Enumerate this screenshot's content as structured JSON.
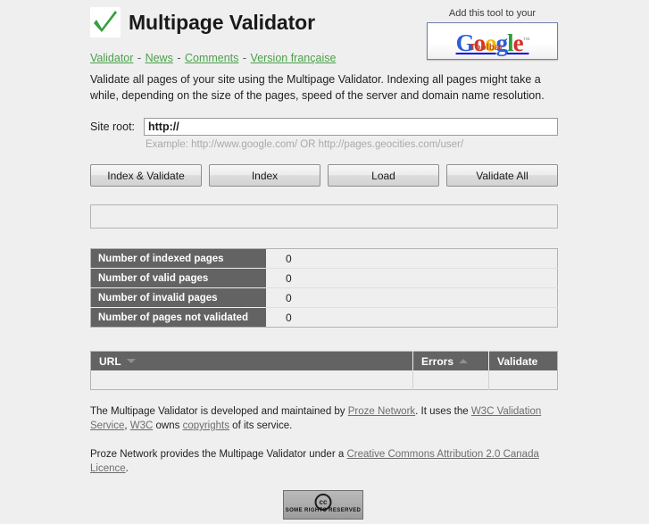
{
  "header": {
    "title": "Multipage Validator",
    "logo_icon": "green-checkmark-icon",
    "nav": [
      {
        "label": "Validator"
      },
      {
        "label": "News"
      },
      {
        "label": "Comments"
      },
      {
        "label": "Version française"
      }
    ],
    "nav_separator": "-"
  },
  "promo": {
    "caption": "Add this tool to your",
    "logo_letters": {
      "g1": "G",
      "o1": "o",
      "o2": "o",
      "g2": "g",
      "l1": "l",
      "e1": "e",
      "tm": "™"
    },
    "toolbar_word": "Toolbar"
  },
  "intro": {
    "text": "Validate all pages of your site using the Multipage Validator. Indexing all pages might take a while, depending on the size of the pages, speed of the server and domain name resolution."
  },
  "form": {
    "site_root_label": "Site root:",
    "site_root_value": "http://",
    "site_root_placeholder": "http://",
    "example_hint": "Example: http://www.google.com/ OR http://pages.geocities.com/user/"
  },
  "buttons": [
    {
      "label": "Index & Validate"
    },
    {
      "label": "Index"
    },
    {
      "label": "Load"
    },
    {
      "label": "Validate All"
    }
  ],
  "status": {
    "message": ""
  },
  "stats": {
    "rows": [
      {
        "label": "Number of indexed pages",
        "value": "0"
      },
      {
        "label": "Number of valid pages",
        "value": "0"
      },
      {
        "label": "Number of invalid pages",
        "value": "0"
      },
      {
        "label": "Number of pages not validated",
        "value": "0"
      }
    ]
  },
  "url_table": {
    "columns": [
      {
        "label": "URL",
        "sort": "desc"
      },
      {
        "label": "Errors",
        "sort": "asc"
      },
      {
        "label": "Validate",
        "sort": "none"
      }
    ],
    "rows": []
  },
  "footer": {
    "line1_a": "The Multipage Validator is developed and maintained by ",
    "link_prose": "Proze Network",
    "line1_b": ". It uses the ",
    "link_w3c_validation": "W3C Validation Service",
    "line1_c": ", ",
    "link_w3c": "W3C",
    "line1_d": " owns ",
    "link_copyrights": "copyrights",
    "line1_e": " of its service.",
    "line2_a": "Proze Network provides the Multipage Validator under a ",
    "link_licence": "Creative Commons Attribution 2.0 Canada Licence",
    "line2_b": ".",
    "cc_badge_mark": "cc",
    "cc_badge_text": "SOME RIGHTS RESERVED"
  },
  "colors": {
    "page_bg": "#efefef",
    "link_green": "#4aa14a",
    "table_header": "#636363",
    "footer_link": "#6d6d6d",
    "check_green": "#2e9e3e"
  }
}
